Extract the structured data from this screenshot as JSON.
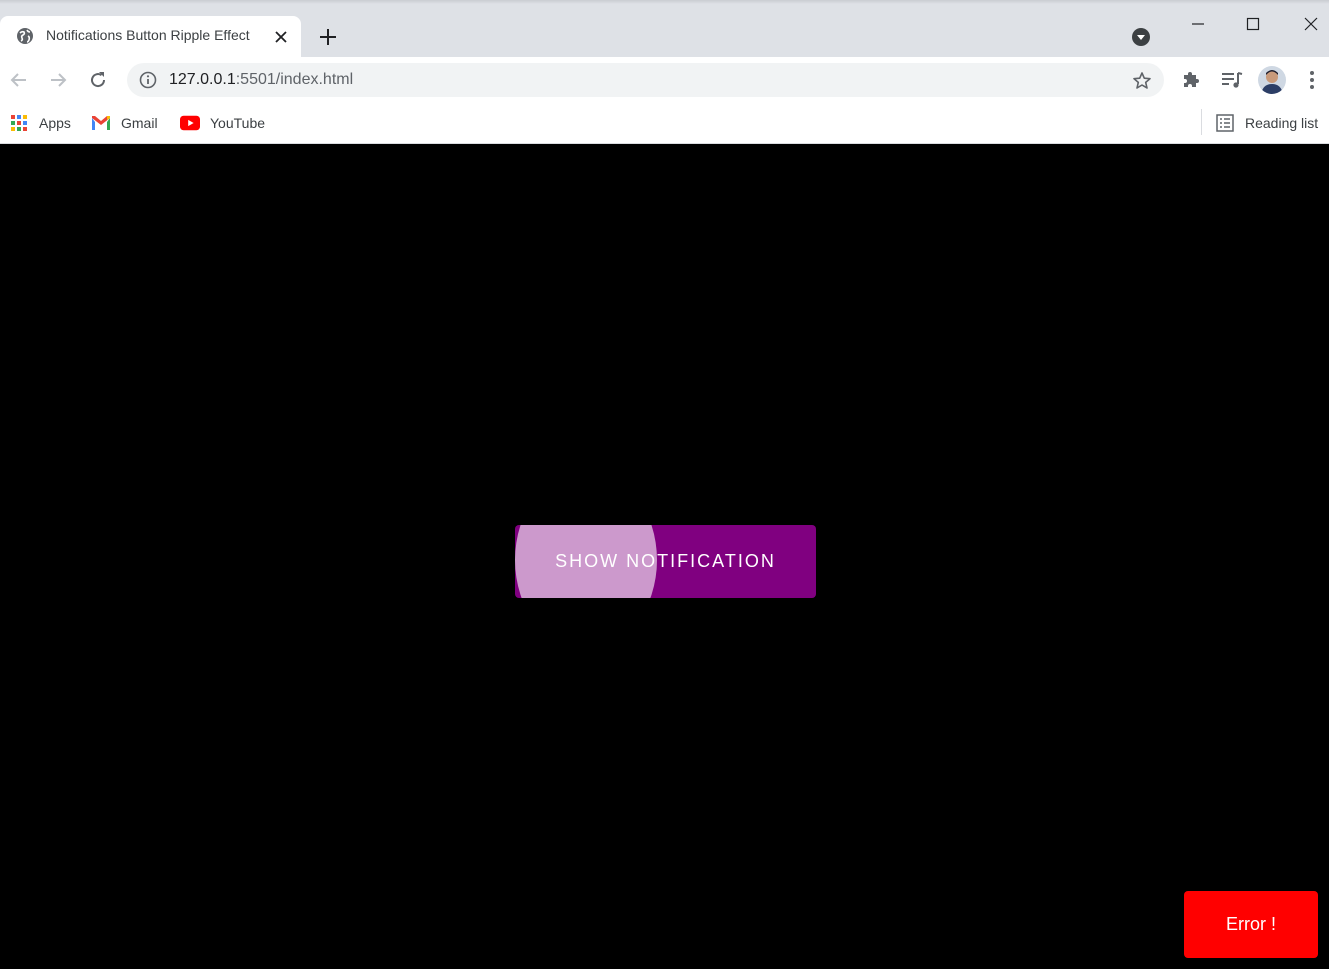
{
  "browser": {
    "tab": {
      "title": "Notifications Button Ripple Effect",
      "favicon": "globe-icon"
    },
    "omnibox": {
      "host": "127.0.0.1",
      "path": ":5501/index.html"
    },
    "bookmarks": [
      {
        "label": "Apps",
        "icon": "apps-grid-icon"
      },
      {
        "label": "Gmail",
        "icon": "gmail-icon"
      },
      {
        "label": "YouTube",
        "icon": "youtube-icon"
      }
    ],
    "reading_list": "Reading list"
  },
  "page": {
    "button_label": "Show Notification",
    "toast_text": "Error !",
    "colors": {
      "button": "#800080",
      "toast": "#ff0000",
      "background": "#000000"
    }
  }
}
